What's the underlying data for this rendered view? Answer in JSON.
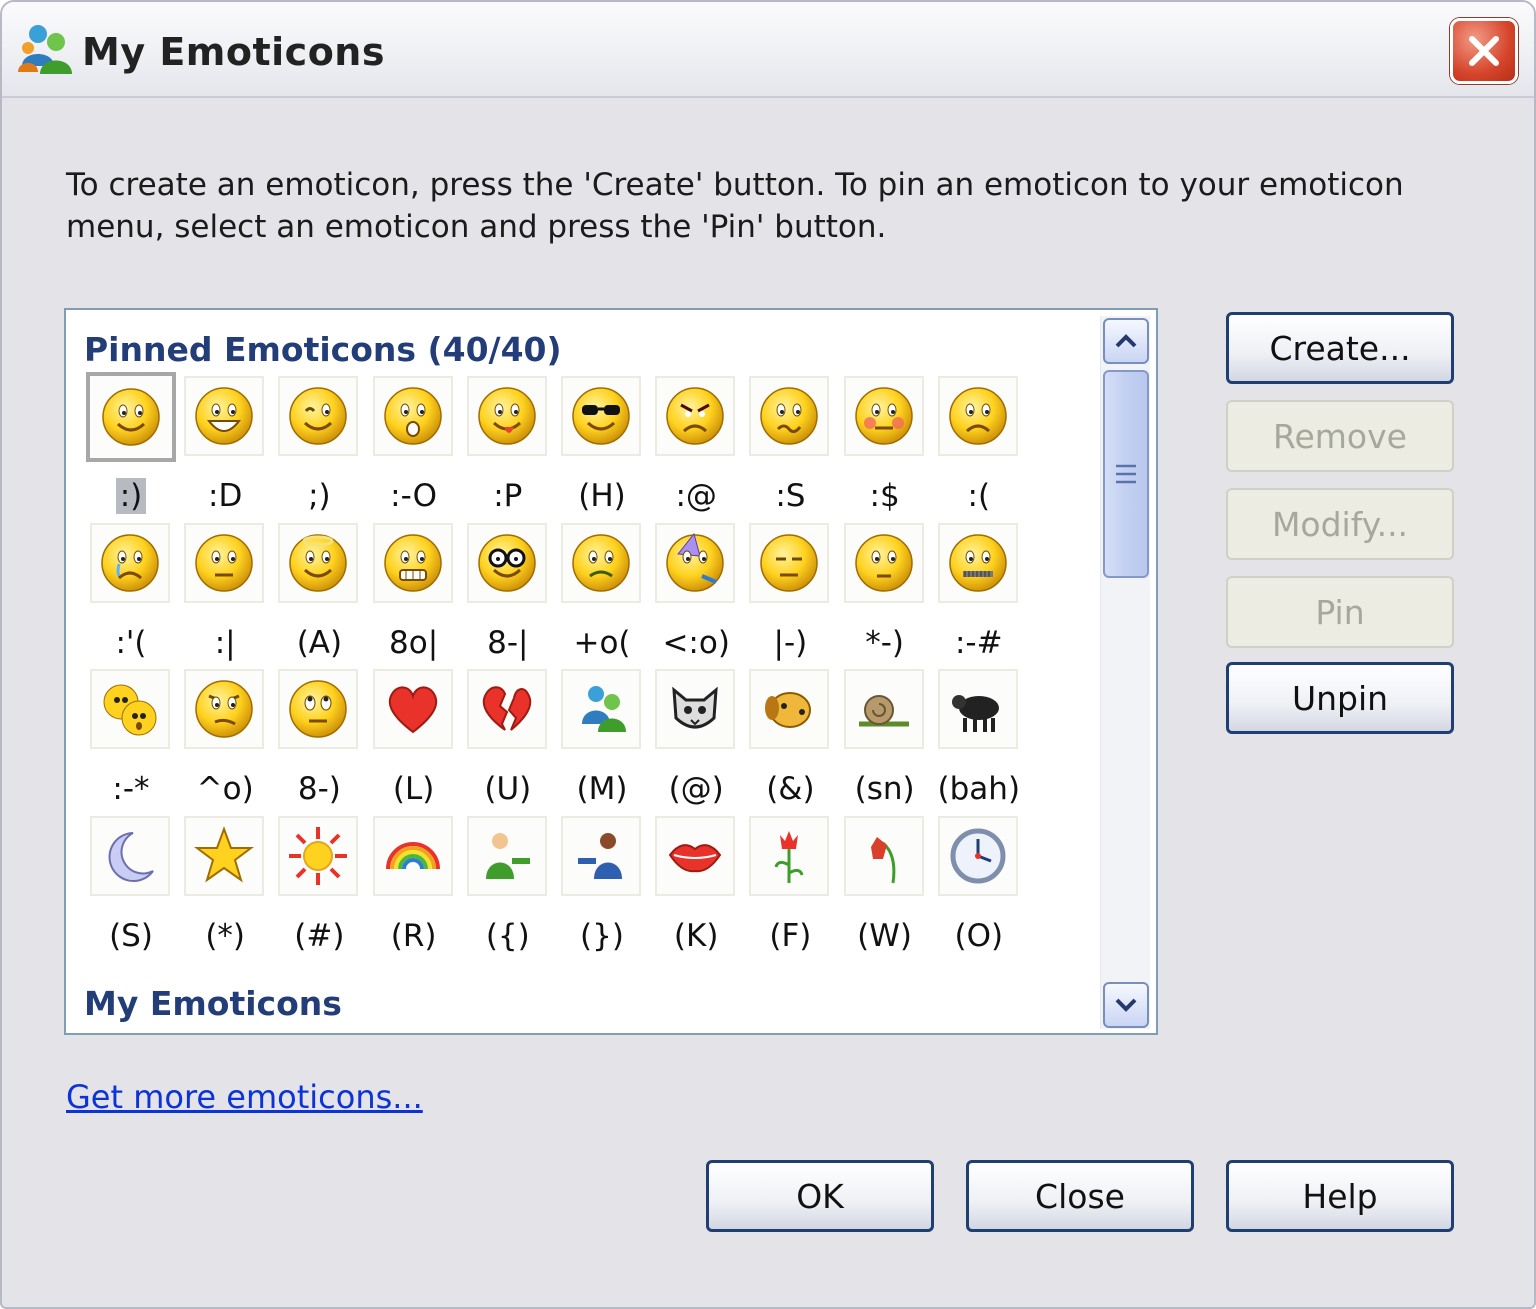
{
  "window": {
    "title": "My Emoticons"
  },
  "instructions": "To create an emoticon, press the 'Create' button.  To pin an emoticon to your emoticon menu, select an emoticon and press the 'Pin' button.",
  "pinned": {
    "title": "Pinned Emoticons (40/40)",
    "emoticons": [
      {
        "code": ":)",
        "icon": "smile-icon",
        "selected": true
      },
      {
        "code": ":D",
        "icon": "open-mouth-smile-icon"
      },
      {
        "code": ";)",
        "icon": "wink-icon"
      },
      {
        "code": ":-O",
        "icon": "surprised-icon"
      },
      {
        "code": ":P",
        "icon": "tongue-out-icon"
      },
      {
        "code": "(H)",
        "icon": "hot-sunglasses-icon"
      },
      {
        "code": ":@",
        "icon": "angry-icon"
      },
      {
        "code": ":S",
        "icon": "confused-icon"
      },
      {
        "code": ":$",
        "icon": "embarrassed-icon"
      },
      {
        "code": ":(",
        "icon": "sad-icon"
      },
      {
        "code": ":'(",
        "icon": "crying-icon"
      },
      {
        "code": ":|",
        "icon": "disappointed-icon"
      },
      {
        "code": "(A)",
        "icon": "angel-icon"
      },
      {
        "code": "8o|",
        "icon": "baring-teeth-icon"
      },
      {
        "code": "8-|",
        "icon": "nerd-icon"
      },
      {
        "code": "+o(",
        "icon": "sick-icon"
      },
      {
        "code": "<:o)",
        "icon": "party-icon"
      },
      {
        "code": "|-)",
        "icon": "sleepy-icon"
      },
      {
        "code": "*-)",
        "icon": "thinking-icon"
      },
      {
        "code": ":-#",
        "icon": "dont-tell-icon"
      },
      {
        "code": ":-*",
        "icon": "secret-telling-icon"
      },
      {
        "code": "^o)",
        "icon": "sarcastic-icon"
      },
      {
        "code": "8-)",
        "icon": "eye-rolling-icon"
      },
      {
        "code": "(L)",
        "icon": "red-heart-icon"
      },
      {
        "code": "(U)",
        "icon": "broken-heart-icon"
      },
      {
        "code": "(M)",
        "icon": "messenger-icon"
      },
      {
        "code": "(@)",
        "icon": "cat-face-icon"
      },
      {
        "code": "(&)",
        "icon": "dog-face-icon"
      },
      {
        "code": "(sn)",
        "icon": "snail-icon"
      },
      {
        "code": "(bah)",
        "icon": "black-sheep-icon"
      },
      {
        "code": "(S)",
        "icon": "sleeping-moon-icon"
      },
      {
        "code": "(*)",
        "icon": "star-icon"
      },
      {
        "code": "(#)",
        "icon": "sun-icon"
      },
      {
        "code": "(R)",
        "icon": "rainbow-icon"
      },
      {
        "code": "({)",
        "icon": "boy-hug-icon"
      },
      {
        "code": "(})",
        "icon": "girl-hug-icon"
      },
      {
        "code": "(K)",
        "icon": "red-lips-icon"
      },
      {
        "code": "(F)",
        "icon": "red-rose-icon"
      },
      {
        "code": "(W)",
        "icon": "wilted-rose-icon"
      },
      {
        "code": "(O)",
        "icon": "clock-icon"
      }
    ]
  },
  "my_emoticons": {
    "title": "My Emoticons"
  },
  "buttons": {
    "create": {
      "label": "Create...",
      "enabled": true
    },
    "remove": {
      "label": "Remove",
      "enabled": false
    },
    "modify": {
      "label": "Modify...",
      "enabled": false
    },
    "pin": {
      "label": "Pin",
      "enabled": false
    },
    "unpin": {
      "label": "Unpin",
      "enabled": true
    },
    "ok": {
      "label": "OK"
    },
    "close": {
      "label": "Close"
    },
    "help": {
      "label": "Help"
    }
  },
  "link": "Get more emoticons..."
}
